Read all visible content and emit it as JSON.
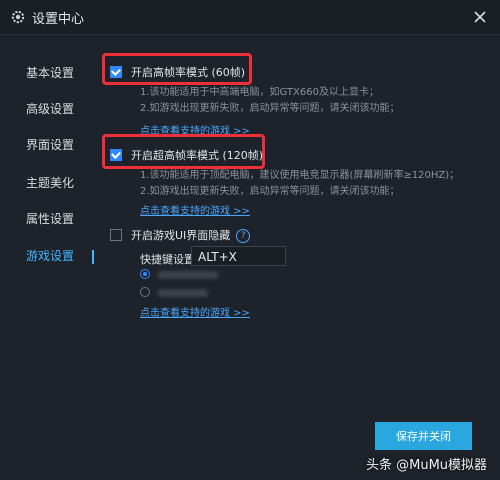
{
  "window": {
    "title": "设置中心"
  },
  "sidebar": {
    "items": [
      {
        "label": "基本设置"
      },
      {
        "label": "高级设置"
      },
      {
        "label": "界面设置"
      },
      {
        "label": "主题美化"
      },
      {
        "label": "属性设置"
      },
      {
        "label": "游戏设置",
        "active": true
      }
    ]
  },
  "settings": {
    "high_fps": {
      "label": "开启高帧率模式 (60帧)",
      "checked": true,
      "desc1": "1.该功能适用于中高端电脑，如GTX660及以上显卡；",
      "desc2": "2.如游戏出现更新失败，启动异常等问题，请关闭该功能；",
      "link": "点击查看支持的游戏 >>"
    },
    "ultra_fps": {
      "label": "开启超高帧率模式 (120帧)",
      "checked": true,
      "desc1": "1.该功能适用于顶配电脑，建议使用电竞显示器(屏幕刷新率≥120HZ)；",
      "desc2": "2.如游戏出现更新失败，启动异常等问题，请关闭该功能；",
      "link": "点击查看支持的游戏 >>"
    },
    "ui_hide": {
      "label": "开启游戏UI界面隐藏",
      "checked": false,
      "help_icon": "?",
      "hotkey_label": "快捷键设置",
      "hotkey_value": "ALT+X",
      "link": "点击查看支持的游戏 >>"
    }
  },
  "buttons": {
    "save_close": "保存并关闭"
  },
  "watermark": "头条 @MuMu模拟器",
  "colors": {
    "accent": "#2aa7de",
    "highlight": "#ef2f39",
    "link": "#4aa8ff"
  }
}
